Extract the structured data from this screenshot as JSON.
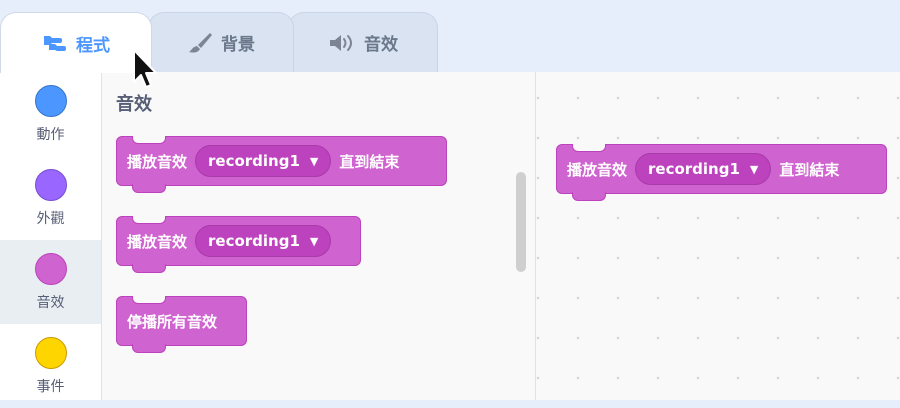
{
  "tabs": {
    "code": {
      "label": "程式",
      "icon": "code-blocks-icon"
    },
    "costumes": {
      "label": "背景",
      "icon": "paintbrush-icon"
    },
    "sounds": {
      "label": "音效",
      "icon": "speaker-icon"
    }
  },
  "categories": [
    {
      "label": "動作",
      "color": "#4c97ff"
    },
    {
      "label": "外觀",
      "color": "#9966ff"
    },
    {
      "label": "音效",
      "color": "#cf63cf"
    },
    {
      "label": "事件",
      "color": "#ffd500"
    }
  ],
  "palette": {
    "title": "音效",
    "blocks": {
      "play_until_done": {
        "text_before": "播放音效",
        "sound": "recording1",
        "text_after": "直到結束"
      },
      "start_sound": {
        "text_before": "播放音效",
        "sound": "recording1"
      },
      "stop_all_sounds": {
        "text": "停播所有音效"
      }
    }
  },
  "workspace": {
    "blocks": {
      "play_until_done": {
        "text_before": "播放音效",
        "sound": "recording1",
        "text_after": "直到結束"
      }
    }
  },
  "colors": {
    "sound_block": "#cf63cf",
    "sound_block_border": "#bd42bd",
    "accent": "#4c97ff"
  }
}
